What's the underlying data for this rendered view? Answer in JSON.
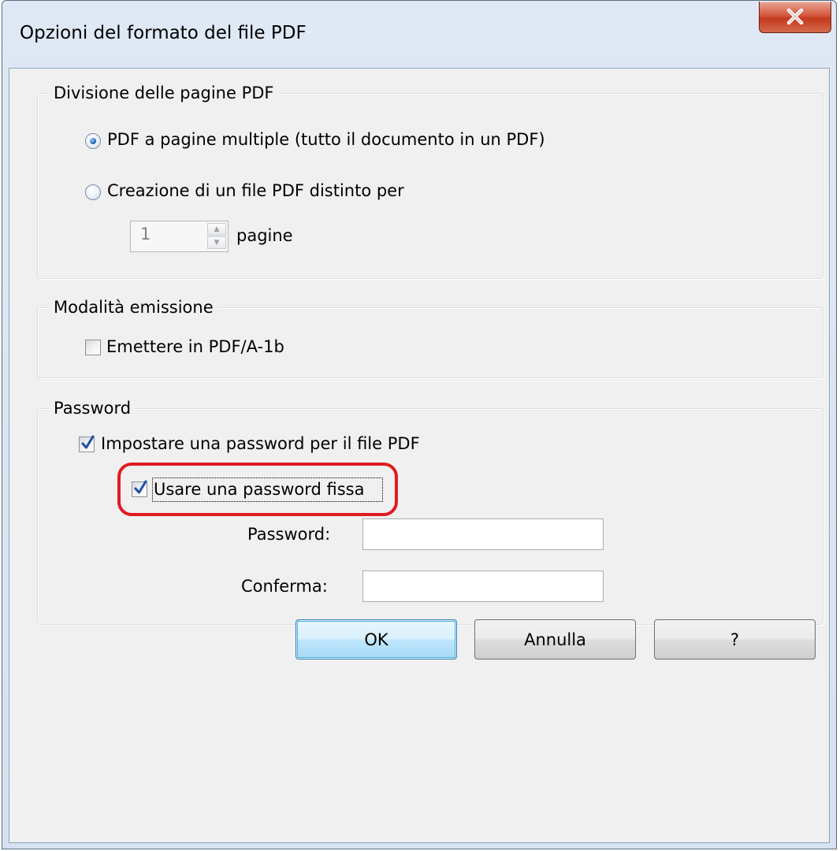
{
  "window": {
    "title": "Opzioni del formato del file PDF"
  },
  "close_button": {
    "icon": "close-icon",
    "glyph": "X"
  },
  "page_division": {
    "legend": "Divisione delle pagine PDF",
    "radio_multipage": {
      "label": "PDF a pagine multiple (tutto il documento in un PDF)",
      "checked": true
    },
    "radio_split": {
      "label": "Creazione di un file PDF distinto per",
      "checked": false
    },
    "pages_value": "1",
    "pages_label": "pagine"
  },
  "output_mode": {
    "legend": "Modalità emissione",
    "pdfa_checkbox": {
      "label": "Emettere in PDF/A-1b",
      "checked": false
    }
  },
  "password": {
    "legend": "Password",
    "set_password_checkbox": {
      "label": "Impostare una password per il file PDF",
      "checked": true
    },
    "fixed_password_checkbox": {
      "label": "Usare una password fissa",
      "checked": true
    },
    "password_label": "Password:",
    "password_value": "",
    "confirm_label": "Conferma:",
    "confirm_value": ""
  },
  "buttons": {
    "ok": "OK",
    "cancel": "Annulla",
    "help": "?"
  },
  "colors": {
    "highlight": "#e01b24",
    "checkmark": "#1f4fa8",
    "window_frame": "#d6e2f1"
  }
}
